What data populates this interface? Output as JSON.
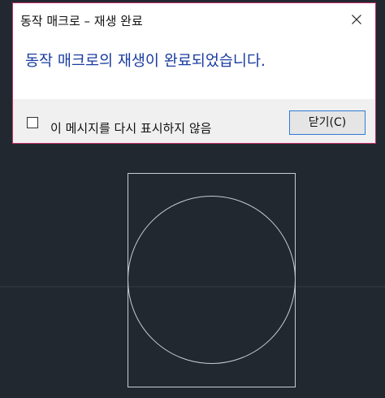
{
  "dialog": {
    "title": "동작 매크로 – 재생 완료",
    "message": "동작 매크로의 재생이 완료되었습니다.",
    "checkbox_label": "이 메시지를 다시 표시하지 않음",
    "checkbox_checked": false,
    "close_button_label": "닫기(C)",
    "close_icon": "close-icon",
    "border_color": "#c0306a",
    "message_color": "#1a3ca0"
  },
  "background": {
    "color": "#212830",
    "drawing": "rectangle-with-inscribed-circle"
  }
}
